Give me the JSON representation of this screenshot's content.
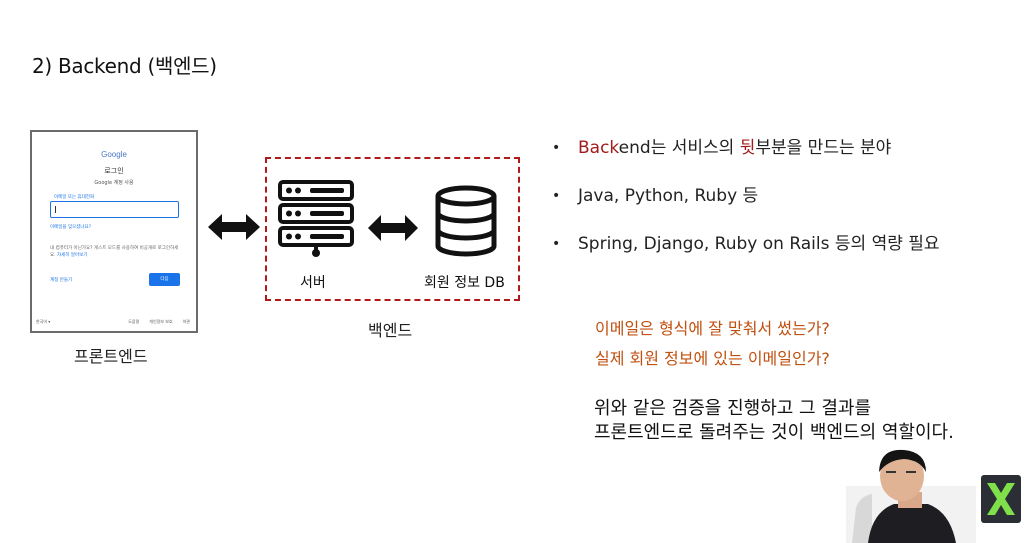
{
  "slide": {
    "title": "2) Backend (백엔드)"
  },
  "frontend": {
    "caption": "프론트엔드",
    "mockup": {
      "logo": "Google",
      "title": "로그인",
      "subtitle": "Google 계정 사용",
      "input_label": "이메일 또는 휴대전화",
      "forgot": "이메일을 잊으셨나요?",
      "guest_text": "내 컴퓨터가 아닌가요? 게스트 모드를 사용하여 비공개로 로그인하세요.",
      "guest_link": "자세히 알아보기",
      "create_account": "계정 만들기",
      "next_button": "다음",
      "footer_lang": "한국어 ▾",
      "footer_links": [
        "도움말",
        "개인정보 보호",
        "약관"
      ]
    }
  },
  "backend": {
    "server_label": "서버",
    "db_label": "회원 정보 DB",
    "caption": "백엔드"
  },
  "bullets": [
    {
      "parts": [
        {
          "text": "Back",
          "red": true
        },
        {
          "text": "end는 서비스의 ",
          "red": false
        },
        {
          "text": "뒷",
          "red": true
        },
        {
          "text": "부분을 만드는 분야",
          "red": false
        }
      ]
    },
    {
      "text": "Java, Python, Ruby 등"
    },
    {
      "text": "Spring, Django, Ruby on Rails 등의 역량 필요"
    }
  ],
  "bullet_symbol": "•",
  "questions": [
    "이메일은 형식에 잘 맞춰서 썼는가?",
    "실제 회원 정보에 있는 이메일인가?"
  ],
  "conclusion": [
    "위와 같은 검증을 진행하고 그 결과를",
    "프론트엔드로 돌려주는 것이 백엔드의 역할이다."
  ],
  "colors": {
    "accent_red": "#a01c1c",
    "question_orange": "#c05010",
    "box_dashed": "#b11a1a",
    "link_blue": "#1a73e8"
  },
  "icons": [
    "double-arrow-icon",
    "server-icon",
    "database-icon",
    "channel-logo-icon"
  ]
}
